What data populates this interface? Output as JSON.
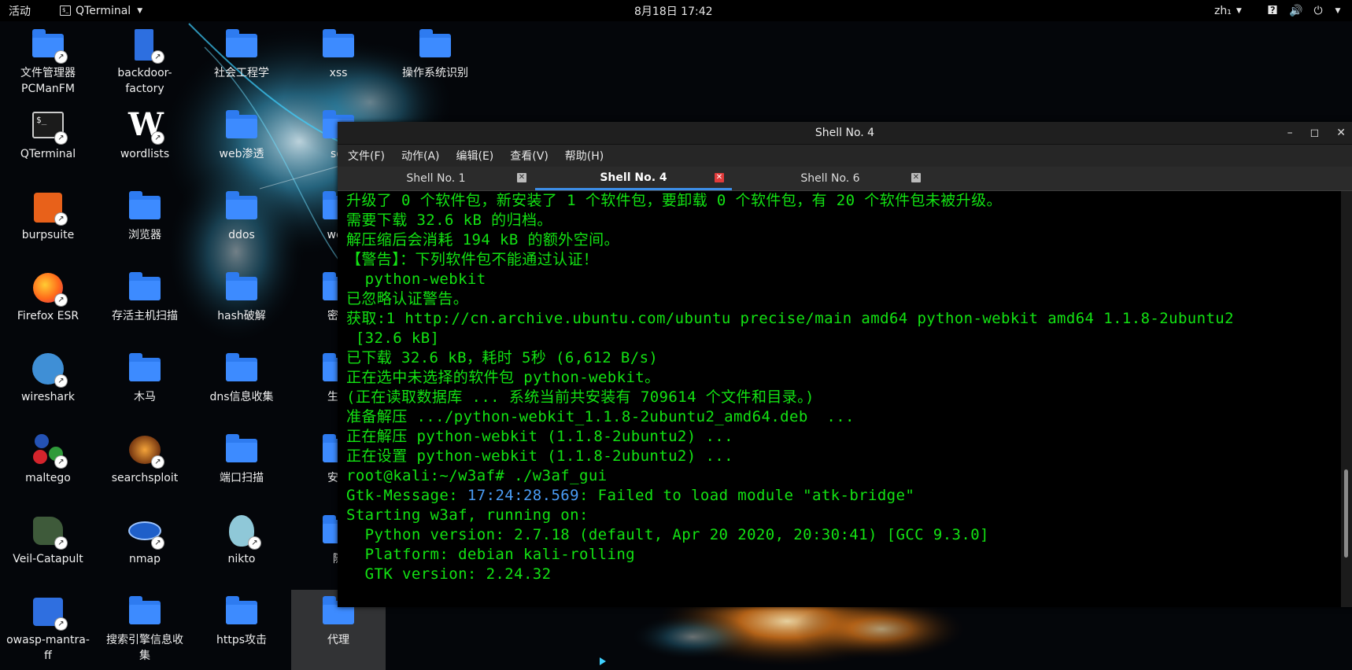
{
  "topbar": {
    "activities": "活动",
    "app_name": "QTerminal",
    "clock": "8月18日 17:42",
    "language": "zh₁"
  },
  "desktop_icons": [
    {
      "label": "文件管理器\nPCManFM",
      "icon": "file-manager-icon"
    },
    {
      "label": "backdoor-\nfactory",
      "icon": "door-icon"
    },
    {
      "label": "社会工程学",
      "icon": "folder-icon"
    },
    {
      "label": "xss",
      "icon": "folder-icon"
    },
    {
      "label": "操作系统识别",
      "icon": "folder-icon"
    },
    {
      "label": "QTerminal",
      "icon": "terminal-icon"
    },
    {
      "label": "wordlists",
      "icon": "wordlists-icon"
    },
    {
      "label": "web渗透",
      "icon": "folder-icon"
    },
    {
      "label": "sql",
      "icon": "folder-icon"
    },
    {
      "label": "burpsuite",
      "icon": "burpsuite-icon"
    },
    {
      "label": "浏览器",
      "icon": "folder-icon"
    },
    {
      "label": "ddos",
      "icon": "folder-icon"
    },
    {
      "label": "web",
      "icon": "folder-icon"
    },
    {
      "label": "Firefox ESR",
      "icon": "firefox-icon"
    },
    {
      "label": "存活主机扫描",
      "icon": "folder-icon"
    },
    {
      "label": "hash破解",
      "icon": "folder-icon"
    },
    {
      "label": "密码",
      "icon": "folder-icon"
    },
    {
      "label": "wireshark",
      "icon": "wireshark-icon"
    },
    {
      "label": "木马",
      "icon": "folder-icon"
    },
    {
      "label": "dns信息收集",
      "icon": "folder-icon"
    },
    {
      "label": "生成",
      "icon": "folder-icon"
    },
    {
      "label": "maltego",
      "icon": "maltego-icon"
    },
    {
      "label": "searchsploit",
      "icon": "searchsploit-icon"
    },
    {
      "label": "端口扫描",
      "icon": "folder-icon"
    },
    {
      "label": "安卓",
      "icon": "folder-icon"
    },
    {
      "label": "Veil-Catapult",
      "icon": "veil-icon"
    },
    {
      "label": "nmap",
      "icon": "nmap-eye-icon"
    },
    {
      "label": "nikto",
      "icon": "nikto-alien-icon"
    },
    {
      "label": "隧",
      "icon": "folder-icon"
    },
    {
      "label": "owasp-mantra-\nff",
      "icon": "owasp-mantra-icon"
    },
    {
      "label": "搜索引擎信息收\n集",
      "icon": "folder-icon"
    },
    {
      "label": "https攻击",
      "icon": "folder-icon"
    },
    {
      "label": "代理",
      "icon": "folder-icon"
    }
  ],
  "window": {
    "title": "Shell No. 4",
    "menu": [
      "文件(F)",
      "动作(A)",
      "编辑(E)",
      "查看(V)",
      "帮助(H)"
    ],
    "tabs": [
      {
        "label": "Shell No. 1",
        "active": false
      },
      {
        "label": "Shell No. 4",
        "active": true
      },
      {
        "label": "Shell No. 6",
        "active": false
      }
    ]
  },
  "terminal": {
    "text_color": "#13e213",
    "timestamp_color": "#4a9cf5",
    "lines": [
      "升级了 0 个软件包，新安装了 1 个软件包，要卸载 0 个软件包，有 20 个软件包未被升级。",
      "需要下载 32.6 kB 的归档。",
      "解压缩后会消耗 194 kB 的额外空间。",
      "【警告】：下列软件包不能通过认证！",
      "  python-webkit",
      "已忽略认证警告。",
      "获取:1 http://cn.archive.ubuntu.com/ubuntu precise/main amd64 python-webkit amd64 1.1.8-2ubuntu2",
      " [32.6 kB]",
      "已下载 32.6 kB，耗时 5秒 (6,612 B/s)",
      "正在选中未选择的软件包 python-webkit。",
      "(正在读取数据库 ... 系统当前共安装有 709614 个文件和目录。)",
      "准备解压 .../python-webkit_1.1.8-2ubuntu2_amd64.deb  ...",
      "正在解压 python-webkit (1.1.8-2ubuntu2) ...",
      "正在设置 python-webkit (1.1.8-2ubuntu2) ...",
      "root@kali:~/w3af# ./w3af_gui"
    ],
    "gtk_prefix": "Gtk-Message: ",
    "gtk_time": "17:24:28.569",
    "gtk_suffix": ": Failed to load module \"atk-bridge\"",
    "tail_lines": [
      "Starting w3af, running on:",
      "  Python version: 2.7.18 (default, Apr 20 2020, 20:30:41) [GCC 9.3.0]",
      "  Platform: debian kali-rolling",
      "  GTK version: 2.24.32"
    ]
  }
}
